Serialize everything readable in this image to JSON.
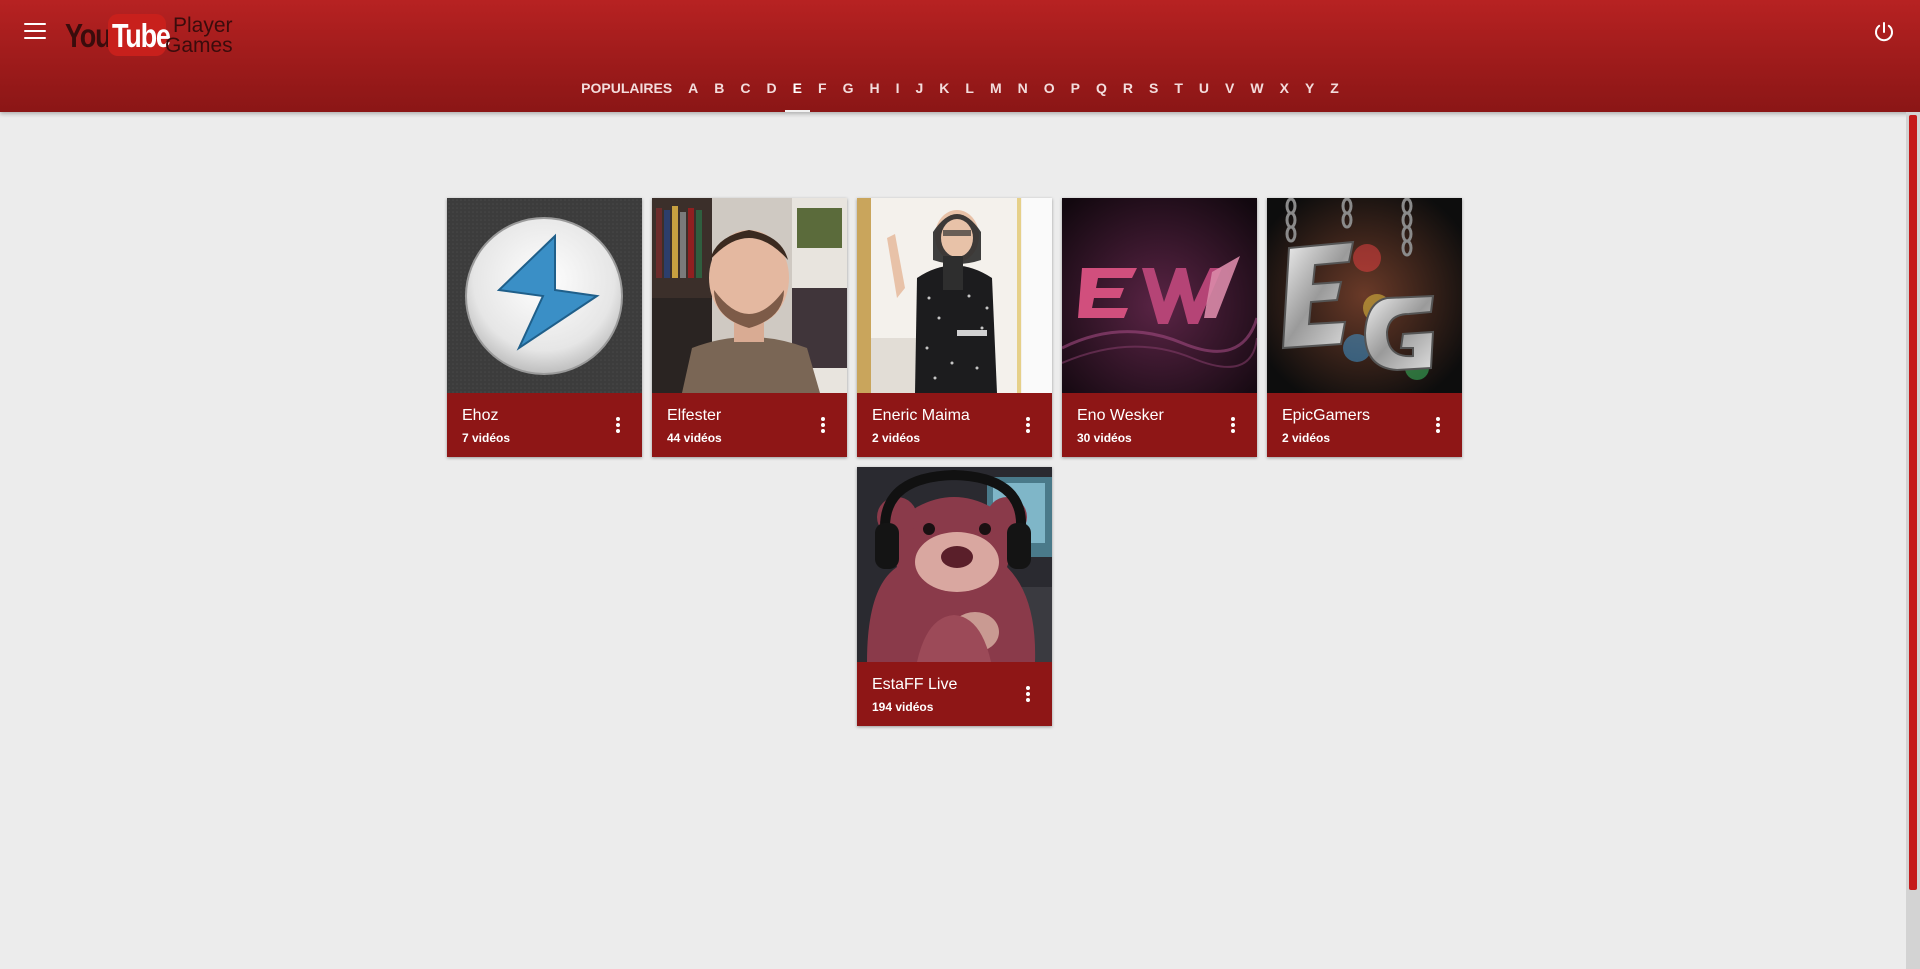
{
  "header": {
    "logo": {
      "you": "You",
      "tube": "Tube",
      "line1": "Player",
      "line2": "Games"
    },
    "menu_icon": "menu-icon",
    "power_icon": "power-icon",
    "colors": {
      "header": "#9e1b1b",
      "card": "#8e1616",
      "background": "#ececec"
    }
  },
  "nav": {
    "active": "E",
    "items": [
      "POPULAIRES",
      "A",
      "B",
      "C",
      "D",
      "E",
      "F",
      "G",
      "H",
      "I",
      "J",
      "K",
      "L",
      "M",
      "N",
      "O",
      "P",
      "Q",
      "R",
      "S",
      "T",
      "U",
      "V",
      "W",
      "X",
      "Y",
      "Z"
    ]
  },
  "channels": [
    {
      "name": "Ehoz",
      "count": "7 vidéos",
      "thumb": "lightning-bolt-logo"
    },
    {
      "name": "Elfester",
      "count": "44 vidéos",
      "thumb": "man-portrait"
    },
    {
      "name": "Eneric Maima",
      "count": "2 vidéos",
      "thumb": "mirror-selfie"
    },
    {
      "name": "Eno Wesker",
      "count": "30 vidéos",
      "thumb": "ew-logo"
    },
    {
      "name": "EpicGamers",
      "count": "2 vidéos",
      "thumb": "eg-logo"
    },
    {
      "name": "EstaFF Live",
      "count": "194 vidéos",
      "thumb": "teddy-bear-headphones"
    }
  ]
}
